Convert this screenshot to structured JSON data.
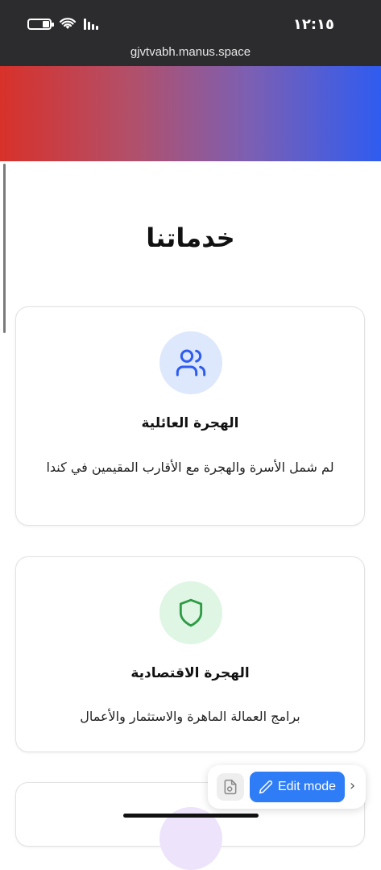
{
  "status_bar": {
    "time": "١٢:١٥",
    "url": "gjvtvabh.manus.space"
  },
  "page": {
    "section_title": "خدماتنا"
  },
  "services": [
    {
      "title": "الهجرة العائلية",
      "description": "لم شمل الأسرة والهجرة مع الأقارب المقيمين في كندا",
      "icon": "users-icon",
      "accent": "#2f5cf0"
    },
    {
      "title": "الهجرة الاقتصادية",
      "description": "برامج العمالة الماهرة والاستثمار والأعمال",
      "icon": "shield-icon",
      "accent": "#2e9b45"
    }
  ],
  "toolbar": {
    "edit_label": "Edit mode"
  },
  "colors": {
    "hero_gradient_start": "#d8312a",
    "hero_gradient_end": "#2f5cf0",
    "edit_button": "#2f7df6"
  }
}
